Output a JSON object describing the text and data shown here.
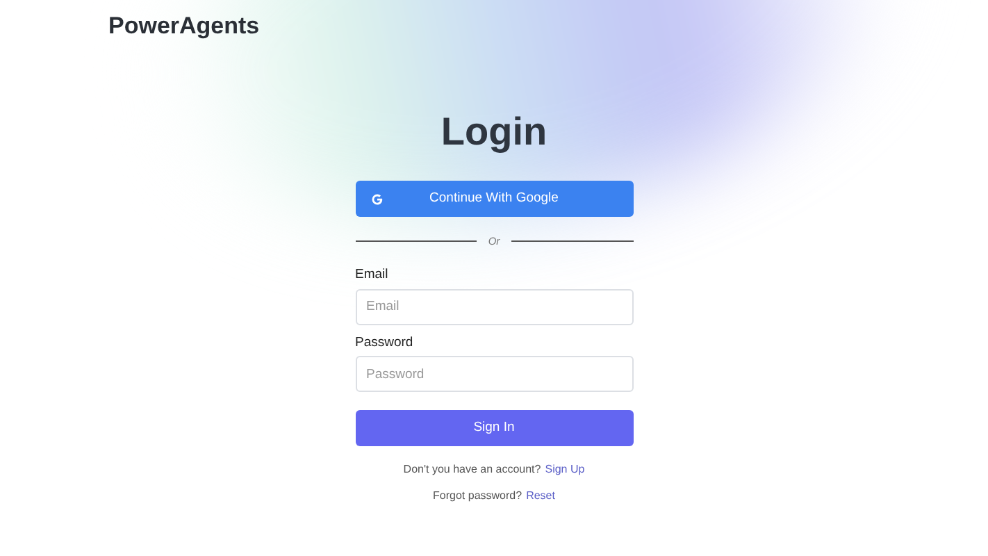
{
  "brand": "PowerAgents",
  "title": "Login",
  "google_button": "Continue With Google",
  "divider": "Or",
  "fields": [
    {
      "label": "Email",
      "placeholder": "Email"
    },
    {
      "label": "Password",
      "placeholder": "Password"
    }
  ],
  "submit": "Sign In",
  "links": [
    {
      "text": "Don't you have an account?",
      "link": "Sign Up"
    },
    {
      "text": "Forgot password?",
      "link": "Reset"
    }
  ]
}
